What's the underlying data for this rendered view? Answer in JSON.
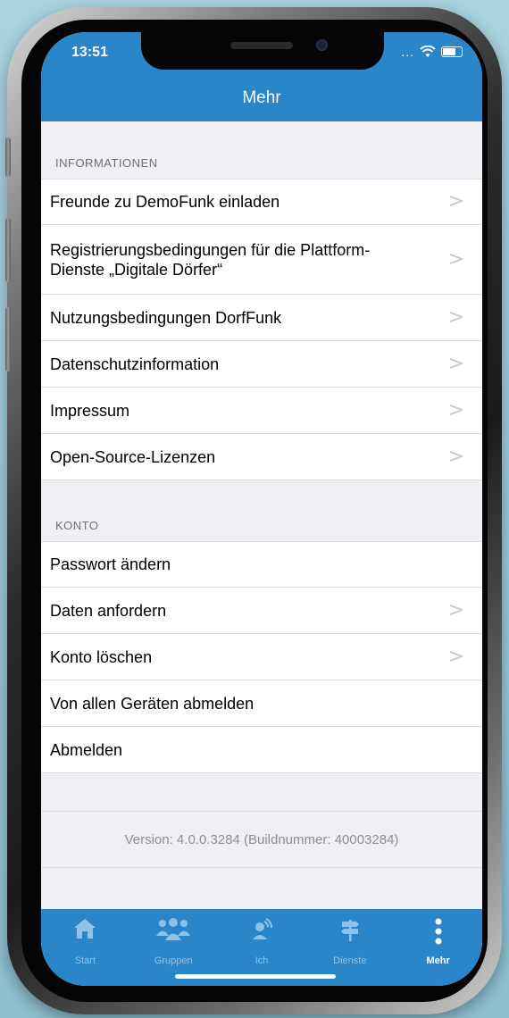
{
  "status": {
    "time": "13:51",
    "signal": "..."
  },
  "nav": {
    "title": "Mehr"
  },
  "sections": [
    {
      "header": "INFORMATIONEN",
      "items": [
        {
          "label": "Freunde zu DemoFunk einladen",
          "chevron": true
        },
        {
          "label": "Registrierungsbedingungen für die Plattform-Dienste „Digitale Dörfer“",
          "chevron": true
        },
        {
          "label": "Nutzungsbedingungen DorfFunk",
          "chevron": true
        },
        {
          "label": "Datenschutzinformation",
          "chevron": true
        },
        {
          "label": "Impressum",
          "chevron": true
        },
        {
          "label": "Open-Source-Lizenzen",
          "chevron": true
        }
      ]
    },
    {
      "header": "KONTO",
      "items": [
        {
          "label": "Passwort ändern",
          "chevron": false
        },
        {
          "label": "Daten anfordern",
          "chevron": true
        },
        {
          "label": "Konto löschen",
          "chevron": true
        },
        {
          "label": "Von allen Geräten abmelden",
          "chevron": false
        },
        {
          "label": "Abmelden",
          "chevron": false
        }
      ]
    }
  ],
  "chevron_glyph": ">",
  "version_text": "Version: 4.0.0.3284 (Buildnummer: 40003284)",
  "tabbar": [
    {
      "label": "Start",
      "icon": "home-icon",
      "active": false
    },
    {
      "label": "Gruppen",
      "icon": "groups-icon",
      "active": false
    },
    {
      "label": "Ich",
      "icon": "person-icon",
      "active": false
    },
    {
      "label": "Dienste",
      "icon": "signpost-icon",
      "active": false
    },
    {
      "label": "Mehr",
      "icon": "more-vertical-icon",
      "active": true
    }
  ],
  "colors": {
    "brand": "#2b86c9",
    "background": "#efeff4",
    "tab_inactive": "#8ec3e9"
  }
}
